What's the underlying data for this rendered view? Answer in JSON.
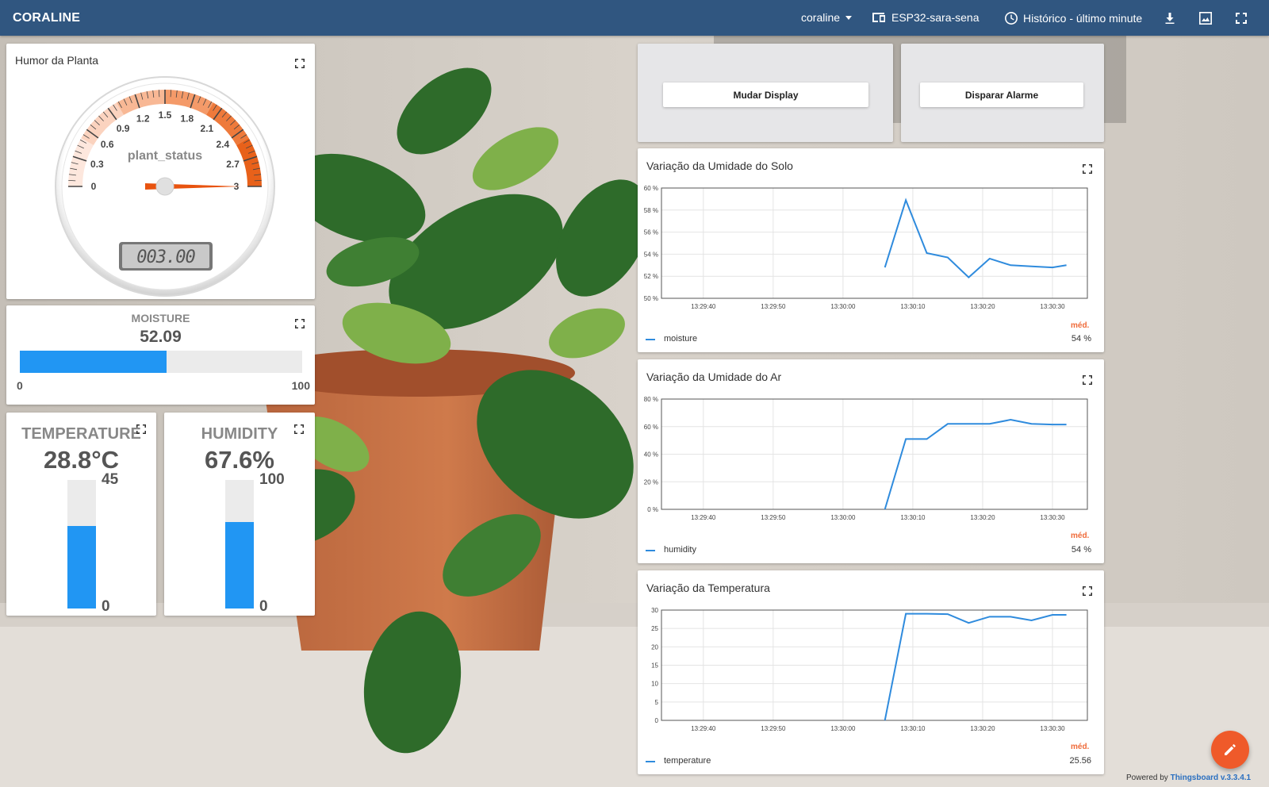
{
  "topbar": {
    "title": "CORALINE",
    "user_menu": "coraline",
    "device": "ESP32-sara-sena",
    "timewindow": "Histórico - último minute",
    "icons": [
      "dropdown-icon",
      "device-icon",
      "clock-icon",
      "download-icon",
      "image-icon",
      "fullscreen-icon"
    ]
  },
  "gauge": {
    "title": "Humor da Planta",
    "center_label": "plant_status",
    "ticks": [
      "0",
      "0.3",
      "0.6",
      "0.9",
      "1.2",
      "1.5",
      "1.8",
      "2.1",
      "2.4",
      "2.7",
      "3"
    ],
    "value": 3,
    "digital_display": "003.00"
  },
  "moisture": {
    "label": "MOISTURE",
    "value": "52.09",
    "min": "0",
    "max": "100",
    "fraction": 0.5209
  },
  "temperature": {
    "label": "TEMPERATURE",
    "value": "28.8°C",
    "max": "45",
    "min": "0",
    "fraction": 0.64
  },
  "humidity": {
    "label": "HUMIDITY",
    "value": "67.6%",
    "max": "100",
    "min": "0",
    "fraction": 0.676
  },
  "buttons": {
    "mudar_display": "Mudar Display",
    "disparar_alarme": "Disparar Alarme"
  },
  "charts": {
    "avg_label": "méd.",
    "x_ticks": [
      "13:29:40",
      "13:29:50",
      "13:30:00",
      "13:30:10",
      "13:30:20",
      "13:30:30"
    ]
  },
  "chart_data": [
    {
      "type": "line",
      "title": "Variação da Umidade do Solo",
      "series": [
        {
          "name": "moisture",
          "color": "#2f8bdd",
          "x": [
            "13:30:06",
            "13:30:09",
            "13:30:12",
            "13:30:15",
            "13:30:18",
            "13:30:21",
            "13:30:24",
            "13:30:27",
            "13:30:30",
            "13:30:32"
          ],
          "values": [
            52.8,
            58.9,
            54.1,
            53.7,
            51.9,
            53.6,
            53.0,
            52.9,
            52.8,
            53.0
          ]
        }
      ],
      "y_ticks": [
        "50 %",
        "52 %",
        "54 %",
        "56 %",
        "58 %",
        "60 %"
      ],
      "ylim": [
        50,
        60
      ],
      "average": "54 %"
    },
    {
      "type": "line",
      "title": "Variação da Umidade do Ar",
      "series": [
        {
          "name": "humidity",
          "color": "#2f8bdd",
          "x": [
            "13:30:06",
            "13:30:09",
            "13:30:12",
            "13:30:15",
            "13:30:18",
            "13:30:21",
            "13:30:24",
            "13:30:27",
            "13:30:30",
            "13:30:32"
          ],
          "values": [
            0,
            51,
            51,
            62,
            62,
            62,
            65,
            62,
            61.5,
            61.5
          ]
        }
      ],
      "y_ticks": [
        "0 %",
        "20 %",
        "40 %",
        "60 %",
        "80 %"
      ],
      "ylim": [
        0,
        80
      ],
      "average": "54 %"
    },
    {
      "type": "line",
      "title": "Variação da Temperatura",
      "series": [
        {
          "name": "temperature",
          "color": "#2f8bdd",
          "x": [
            "13:30:06",
            "13:30:09",
            "13:30:12",
            "13:30:15",
            "13:30:18",
            "13:30:21",
            "13:30:24",
            "13:30:27",
            "13:30:30",
            "13:30:32"
          ],
          "values": [
            0,
            29,
            29,
            28.9,
            26.5,
            28.2,
            28.2,
            27.2,
            28.7,
            28.7
          ]
        }
      ],
      "y_ticks": [
        "0",
        "5",
        "10",
        "15",
        "20",
        "25",
        "30"
      ],
      "ylim": [
        0,
        30
      ],
      "average": "25.56"
    }
  ],
  "footer": {
    "powered_by": "Powered by",
    "brand": "Thingsboard v.3.3.4.1"
  }
}
